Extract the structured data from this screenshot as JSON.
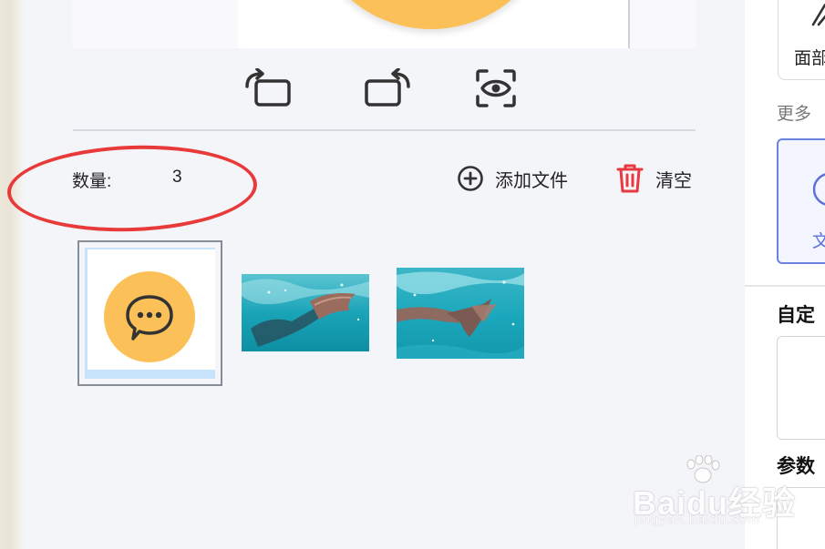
{
  "main": {
    "count_label": "数量:",
    "count_value": "3",
    "add_file_label": "添加文件",
    "clear_label": "清空",
    "toolbar": {
      "rotate_left_icon": "rotate-left-icon",
      "rotate_right_icon": "rotate-right-icon",
      "preview_icon": "eye-scan-icon"
    },
    "thumbnails": [
      {
        "kind": "chat-icon-image",
        "selected": true
      },
      {
        "kind": "underwater-photo",
        "selected": false
      },
      {
        "kind": "underwater-photo",
        "selected": false
      }
    ]
  },
  "right_panel": {
    "card1_label": "面部",
    "more_label": "更多",
    "card2_label": "文",
    "section1_heading": "自定",
    "section2_heading": "参数"
  },
  "watermark": {
    "main": "Baidu经验",
    "sub": "jingyan.baidu.com"
  },
  "colors": {
    "accent_yellow": "#fbc158",
    "selection_blue": "#c7e2fb",
    "annotation_red": "#e93a3a",
    "trash_red": "#e9383f",
    "link_blue": "#5b72d8"
  }
}
